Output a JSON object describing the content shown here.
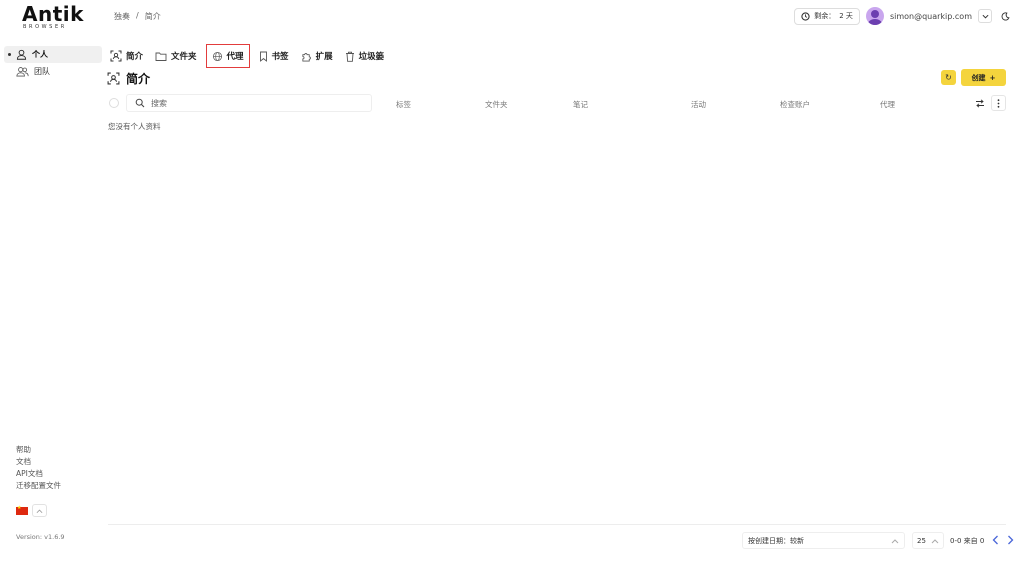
{
  "logo": {
    "main": "Antik",
    "sub": "BROWSER"
  },
  "breadcrumb": {
    "root": "独奏",
    "sep": "/",
    "current": "简介"
  },
  "header": {
    "remain_label": "剩余：",
    "remain_value": "2 天",
    "email": "simon@quarkip.com"
  },
  "sidebar": {
    "items": [
      {
        "label": "个人",
        "active": true
      },
      {
        "label": "团队",
        "active": false
      }
    ]
  },
  "tabs": [
    {
      "label": "简介",
      "icon": "profile-scan-icon"
    },
    {
      "label": "文件夹",
      "icon": "folder-icon"
    },
    {
      "label": "代理",
      "icon": "proxy-globe-icon"
    },
    {
      "label": "书签",
      "icon": "bookmark-icon"
    },
    {
      "label": "扩展",
      "icon": "puzzle-icon"
    },
    {
      "label": "垃圾篓",
      "icon": "trash-icon"
    }
  ],
  "page": {
    "title": "简介",
    "create_label": "创建",
    "create_symbol": "+",
    "refresh_symbol": "↻"
  },
  "table": {
    "search_placeholder": "搜索",
    "columns": [
      "标签",
      "文件夹",
      "笔记",
      "活动",
      "检查账户",
      "代理"
    ],
    "empty_text": "您没有个人资料"
  },
  "links": [
    "帮助",
    "文档",
    "API文档",
    "迁移配置文件"
  ],
  "version": "Version: v1.6.9",
  "footer": {
    "sort_label": "按创建日期：较新",
    "page_size": "25",
    "page_info": "0-0 来自 0"
  },
  "colors": {
    "accent": "#f4d43d",
    "highlight_border": "#e23c3c",
    "pager": "#4a66d9"
  }
}
